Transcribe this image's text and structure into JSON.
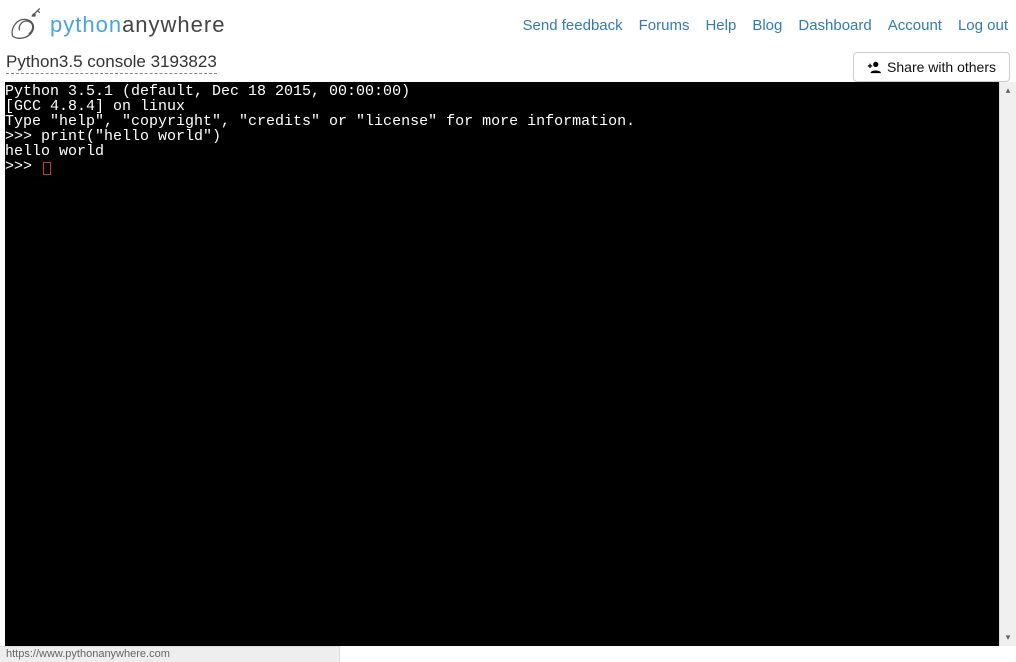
{
  "brand": {
    "prefix": "python",
    "suffix": "anywhere"
  },
  "nav": {
    "feedback": "Send feedback",
    "forums": "Forums",
    "help": "Help",
    "blog": "Blog",
    "dashboard": "Dashboard",
    "account": "Account",
    "logout": "Log out"
  },
  "console_title": "Python3.5 console 3193823",
  "share_label": "Share with others",
  "terminal": {
    "line1": "Python 3.5.1 (default, Dec 18 2015, 00:00:00)",
    "line2": "[GCC 4.8.4] on linux",
    "line3": "Type \"help\", \"copyright\", \"credits\" or \"license\" for more information.",
    "line4": ">>> print(\"hello world\")",
    "line5": "hello world",
    "line6": ">>> "
  },
  "status_url": "https://www.pythonanywhere.com"
}
